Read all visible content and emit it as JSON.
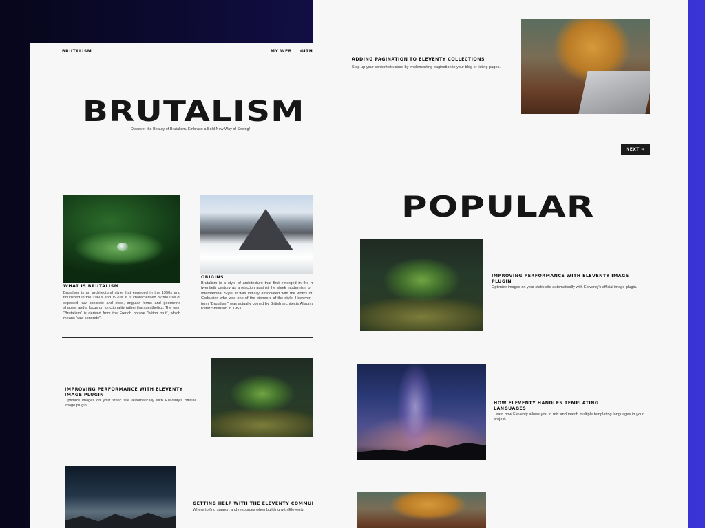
{
  "left": {
    "brand": "BRUTALISM",
    "nav": [
      "MY WEB",
      "GITH"
    ],
    "hero_title": "BRUTALISM",
    "hero_subtitle": "Discover the Beauty of Brutalism. Embrace a Bold New Way of Seeing!",
    "cards": [
      {
        "title": "WHAT IS BRUTALISM",
        "text": "Brutalism is an architectural style that emerged in the 1950s and flourished in the 1960s and 1970s. It is characterized by the use of exposed raw concrete and steel, angular forms and geometric shapes, and a focus on functionality rather than aesthetics. The term “Brutalism” is derived from the French phrase “béton brut”, which means “raw concrete”.",
        "image_icon": "leaf-dewdrop-photo"
      },
      {
        "title": "ORIGINS",
        "text": "Brutalism is a style of architecture that first emerged in the mid-twentieth century as a reaction against the sleek modernism of the International Style. It was initially associated with the works of Le Corbusier, who was one of the pioneers of the style. However, the term “Brutalism” was actually coined by British architects Alison and Peter Smithson in 1953.",
        "image_icon": "snowy-mountain-photo"
      }
    ],
    "posts": [
      {
        "title": "IMPROVING PERFORMANCE WITH ELEVENTY IMAGE PLUGIN",
        "text": "Optimize images on your static site automatically with Eleventy's official image plugin.",
        "image_icon": "moss-sapling-photo"
      },
      {
        "title": "GETTING HELP WITH THE ELEVENTY COMMUNITY",
        "text": "Where to find support and resources when building with Eleventy.",
        "image_icon": "night-mountains-photo"
      }
    ]
  },
  "right": {
    "pagination_post": {
      "title": "ADDING PAGINATION TO ELEVENTY COLLECTIONS",
      "text": "Step up your content structure by implementing pagination in your blog or listing pages.",
      "image_icon": "laptop-typing-photo"
    },
    "next_label": "NEXT →",
    "section_title": "POPULAR",
    "popular": [
      {
        "title": "IMPROVING PERFORMANCE WITH ELEVENTY IMAGE PLUGIN",
        "text": "Optimize images on your static site automatically with Eleventy's official image plugin.",
        "image_icon": "moss-sapling-photo"
      },
      {
        "title": "HOW ELEVENTY HANDLES TEMPLATING LANGUAGES",
        "text": "Learn how Eleventy allows you to mix and match multiple templating languages in your project.",
        "image_icon": "milky-way-photo"
      },
      {
        "title": "",
        "text": "",
        "image_icon": "laptop-typing-photo"
      }
    ]
  },
  "colors": {
    "page_bg": "#f7f7f7",
    "ink": "#161616",
    "backdrop_start": "#07061a",
    "backdrop_end": "#3a34d6"
  }
}
